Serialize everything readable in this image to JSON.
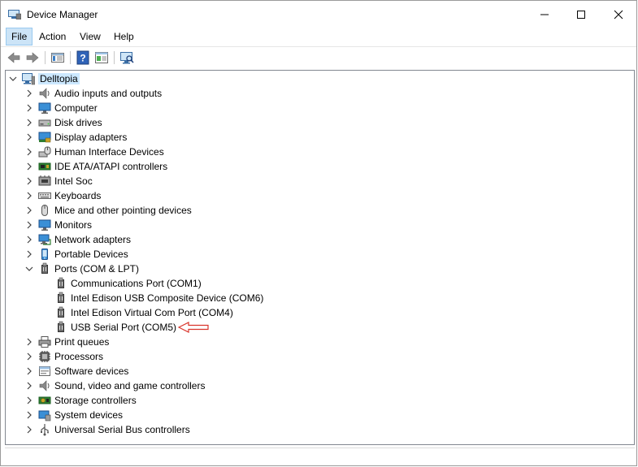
{
  "window": {
    "title": "Device Manager"
  },
  "menu": [
    {
      "label": "File",
      "active": true
    },
    {
      "label": "Action",
      "active": false
    },
    {
      "label": "View",
      "active": false
    },
    {
      "label": "Help",
      "active": false
    }
  ],
  "toolbar": [
    "back-icon",
    "forward-icon",
    "console-tree-icon",
    "help-icon",
    "properties-icon",
    "scan-hardware-icon"
  ],
  "tree": {
    "root": {
      "label": "Delltopia",
      "icon": "computer-icon",
      "expanded": true
    },
    "categories": [
      {
        "label": "Audio inputs and outputs",
        "icon": "speaker-icon",
        "expanded": false
      },
      {
        "label": "Computer",
        "icon": "monitor-icon",
        "expanded": false
      },
      {
        "label": "Disk drives",
        "icon": "disk-drive-icon",
        "expanded": false
      },
      {
        "label": "Display adapters",
        "icon": "display-adapter-icon",
        "expanded": false
      },
      {
        "label": "Human Interface Devices",
        "icon": "hid-icon",
        "expanded": false
      },
      {
        "label": "IDE ATA/ATAPI controllers",
        "icon": "ide-controller-icon",
        "expanded": false
      },
      {
        "label": "Intel Soc",
        "icon": "soc-icon",
        "expanded": false
      },
      {
        "label": "Keyboards",
        "icon": "keyboard-icon",
        "expanded": false
      },
      {
        "label": "Mice and other pointing devices",
        "icon": "mouse-icon",
        "expanded": false
      },
      {
        "label": "Monitors",
        "icon": "monitor-icon",
        "expanded": false
      },
      {
        "label": "Network adapters",
        "icon": "network-icon",
        "expanded": false
      },
      {
        "label": "Portable Devices",
        "icon": "portable-device-icon",
        "expanded": false
      },
      {
        "label": "Ports (COM & LPT)",
        "icon": "port-icon",
        "expanded": true,
        "children": [
          {
            "label": "Communications Port (COM1)",
            "icon": "port-icon"
          },
          {
            "label": "Intel Edison USB Composite Device (COM6)",
            "icon": "port-icon"
          },
          {
            "label": "Intel Edison Virtual Com Port (COM4)",
            "icon": "port-icon"
          },
          {
            "label": "USB Serial Port (COM5)",
            "icon": "port-icon"
          }
        ]
      },
      {
        "label": "Print queues",
        "icon": "printer-icon",
        "expanded": false
      },
      {
        "label": "Processors",
        "icon": "processor-icon",
        "expanded": false
      },
      {
        "label": "Software devices",
        "icon": "software-device-icon",
        "expanded": false
      },
      {
        "label": "Sound, video and game controllers",
        "icon": "speaker-icon",
        "expanded": false
      },
      {
        "label": "Storage controllers",
        "icon": "storage-controller-icon",
        "expanded": false
      },
      {
        "label": "System devices",
        "icon": "system-device-icon",
        "expanded": false
      },
      {
        "label": "Universal Serial Bus controllers",
        "icon": "usb-icon",
        "expanded": false
      }
    ]
  },
  "colors": {
    "selection": "#cce8ff",
    "menu_active": "#cce4f7",
    "annotation_arrow": "#d9342b"
  }
}
